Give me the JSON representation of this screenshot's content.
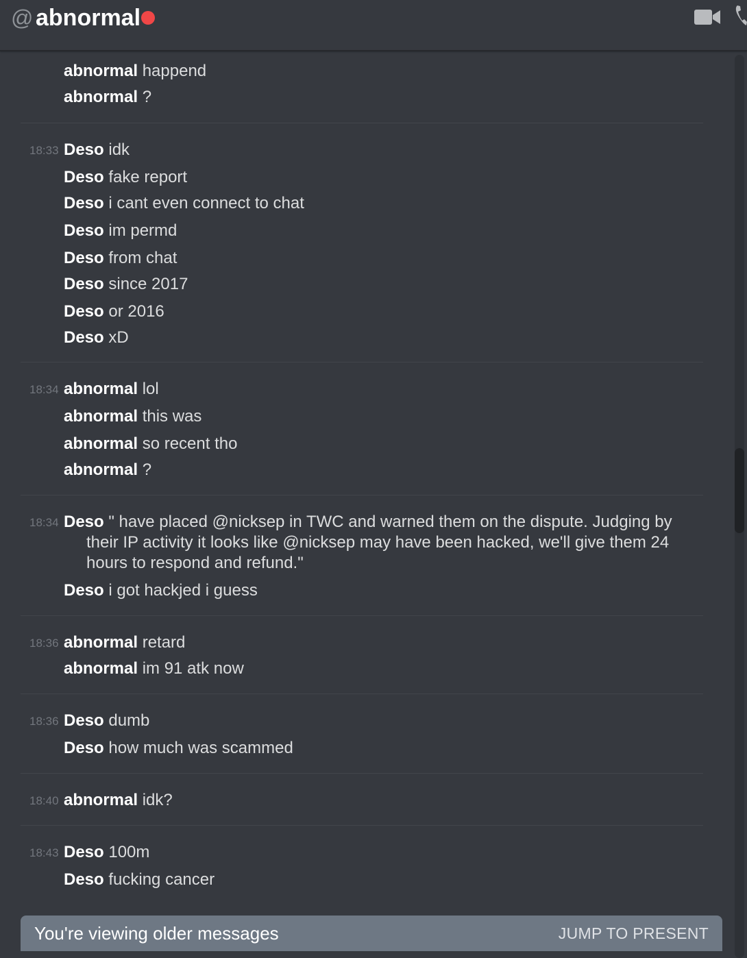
{
  "header": {
    "at_symbol": "@",
    "title": "abnormal",
    "status_color": "#f04747"
  },
  "groups": [
    {
      "timestamp": "",
      "lines": [
        {
          "author": "abnormal",
          "text": "happend"
        },
        {
          "author": "abnormal",
          "text": "?"
        }
      ]
    },
    {
      "timestamp": "18:33",
      "lines": [
        {
          "author": "Deso",
          "text": "idk"
        },
        {
          "author": "Deso",
          "text": "fake report"
        },
        {
          "author": "Deso",
          "text": "i cant even connect to chat"
        },
        {
          "author": "Deso",
          "text": "im permd"
        },
        {
          "author": "Deso",
          "text": "from chat"
        },
        {
          "author": "Deso",
          "text": "since 2017"
        },
        {
          "author": "Deso",
          "text": "or 2016"
        },
        {
          "author": "Deso",
          "text": "xD"
        }
      ]
    },
    {
      "timestamp": "18:34",
      "lines": [
        {
          "author": "abnormal",
          "text": "lol"
        },
        {
          "author": "abnormal",
          "text": "this was"
        },
        {
          "author": "abnormal",
          "text": "so recent tho"
        },
        {
          "author": "abnormal",
          "text": "?"
        }
      ]
    },
    {
      "timestamp": "18:34",
      "lines": [
        {
          "author": "Deso",
          "text": "\" have placed @nicksep in TWC and warned them on the dispute. Judging by",
          "continuation": "their IP activity it looks like @nicksep may have been hacked, we'll give them 24 hours to respond and refund.\""
        },
        {
          "author": "Deso",
          "text": "i got hackjed i guess"
        }
      ]
    },
    {
      "timestamp": "18:36",
      "lines": [
        {
          "author": "abnormal",
          "text": "retard"
        },
        {
          "author": "abnormal",
          "text": "im 91 atk now"
        }
      ]
    },
    {
      "timestamp": "18:36",
      "lines": [
        {
          "author": "Deso",
          "text": "dumb"
        },
        {
          "author": "Deso",
          "text": "how much was scammed"
        }
      ]
    },
    {
      "timestamp": "18:40",
      "lines": [
        {
          "author": "abnormal",
          "text": "idk?"
        }
      ]
    },
    {
      "timestamp": "18:43",
      "lines": [
        {
          "author": "Deso",
          "text": "100m"
        },
        {
          "author": "Deso",
          "text": "fucking cancer"
        }
      ]
    }
  ],
  "older_bar": {
    "message": "You're viewing older messages",
    "action": "JUMP TO PRESENT"
  }
}
